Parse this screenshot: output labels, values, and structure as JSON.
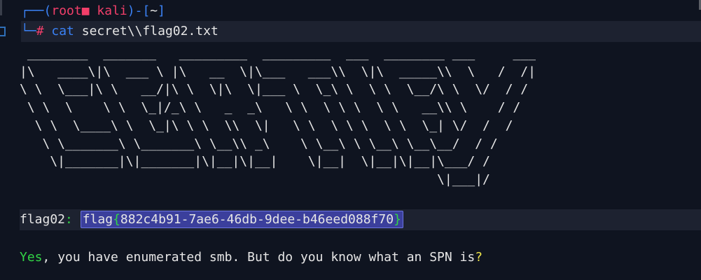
{
  "prompt": {
    "corner_top": "┌──(",
    "user": "root",
    "host": "kali",
    "close_paren": ")-[",
    "path": "~",
    "close_bracket": "]",
    "corner_bottom": "└─",
    "hash": "#",
    "command": "cat",
    "argument": "secret\\\\flag02.txt"
  },
  "ascii_art": [
    " ________  _______   _________  _________  ___  ________ ___     ___",
    "|\\   ____\\|\\  ___ \\ |\\   __  \\|\\___   ___\\\\  \\|\\  _____\\\\  \\   /  /|",
    "\\ \\  \\___|\\ \\   __/|\\ \\  \\|\\  \\|___ \\  \\_\\ \\  \\ \\  \\__/\\ \\  \\/  / /",
    " \\ \\  \\    \\ \\  \\_|/_\\ \\   _  _\\   \\ \\  \\ \\ \\  \\ \\   __\\\\ \\    / /",
    "  \\ \\  \\____\\ \\  \\_|\\ \\ \\  \\\\  \\|   \\ \\  \\ \\ \\  \\ \\  \\_| \\/  /  /",
    "   \\ \\_______\\ \\_______\\ \\__\\\\ _\\    \\ \\__\\ \\ \\__\\ \\__\\__/  / /",
    "    \\|_______|\\|_______|\\|__|\\|__|    \\|__|  \\|__|\\|__|\\___/ /",
    "                                                       \\|___|/"
  ],
  "flag": {
    "label": "flag02",
    "colon": ":",
    "word": "flag",
    "open_brace": "{",
    "value": "882c4b91-7ae6-46db-9dee-b46eed088f70",
    "close_brace": "}"
  },
  "message": {
    "yes": "Yes",
    "rest": ", you have enumerated smb. But do you know what an SPN is",
    "question": "?"
  }
}
